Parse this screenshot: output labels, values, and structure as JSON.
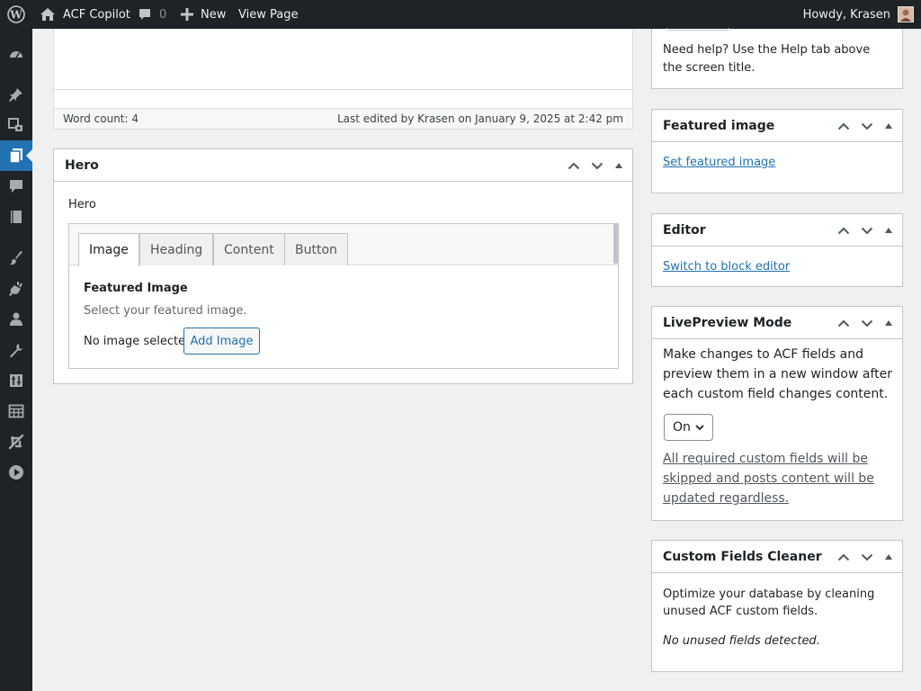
{
  "adminbar": {
    "site_name": "ACF Copilot",
    "comments_count": "0",
    "new_label": "New",
    "view_page_label": "View Page",
    "howdy": "Howdy, Krasen"
  },
  "sidebar_menu": {
    "icons": [
      "dashboard-icon",
      "posts-pin-icon",
      "media-icon",
      "pages-icon",
      "comments-icon",
      "library-icon",
      "appearance-brush-icon",
      "plugins-icon",
      "users-icon",
      "tools-wrench-icon",
      "settings-sort-icon",
      "table-icon",
      "plane-icon",
      "play-icon"
    ],
    "current": "pages-icon"
  },
  "editor": {
    "word_count": "Word count: 4",
    "last_edited": "Last edited by Krasen on January 9, 2025 at 2:42 pm"
  },
  "hero": {
    "title": "Hero",
    "field_label": "Hero",
    "tabs": [
      {
        "label": "Image",
        "active": true
      },
      {
        "label": "Heading",
        "active": false
      },
      {
        "label": "Content",
        "active": false
      },
      {
        "label": "Button",
        "active": false
      }
    ],
    "image_field": {
      "label": "Featured Image",
      "description": "Select your featured image.",
      "empty_text": "No image selected",
      "button_label": "Add Image"
    }
  },
  "sidebar": {
    "help_text": "Need help? Use the Help tab above the screen title.",
    "featured_image": {
      "title": "Featured image",
      "link": "Set featured image"
    },
    "editor_box": {
      "title": "Editor",
      "link": "Switch to block editor"
    },
    "live_preview": {
      "title": "LivePreview Mode",
      "description": "Make changes to ACF fields and preview them in a new window after each custom field changes content.",
      "select_value": "On",
      "note": "All required custom fields will be skipped and posts content will be updated regardless."
    },
    "cleaner": {
      "title": "Custom Fields Cleaner",
      "description": "Optimize your database by cleaning unused ACF custom fields.",
      "status": "No unused fields detected."
    }
  },
  "colors": {
    "adminbar_bg": "#1d2327",
    "accent": "#2271b1",
    "page_bg": "#f0f0f1",
    "border": "#c3c4c7"
  }
}
